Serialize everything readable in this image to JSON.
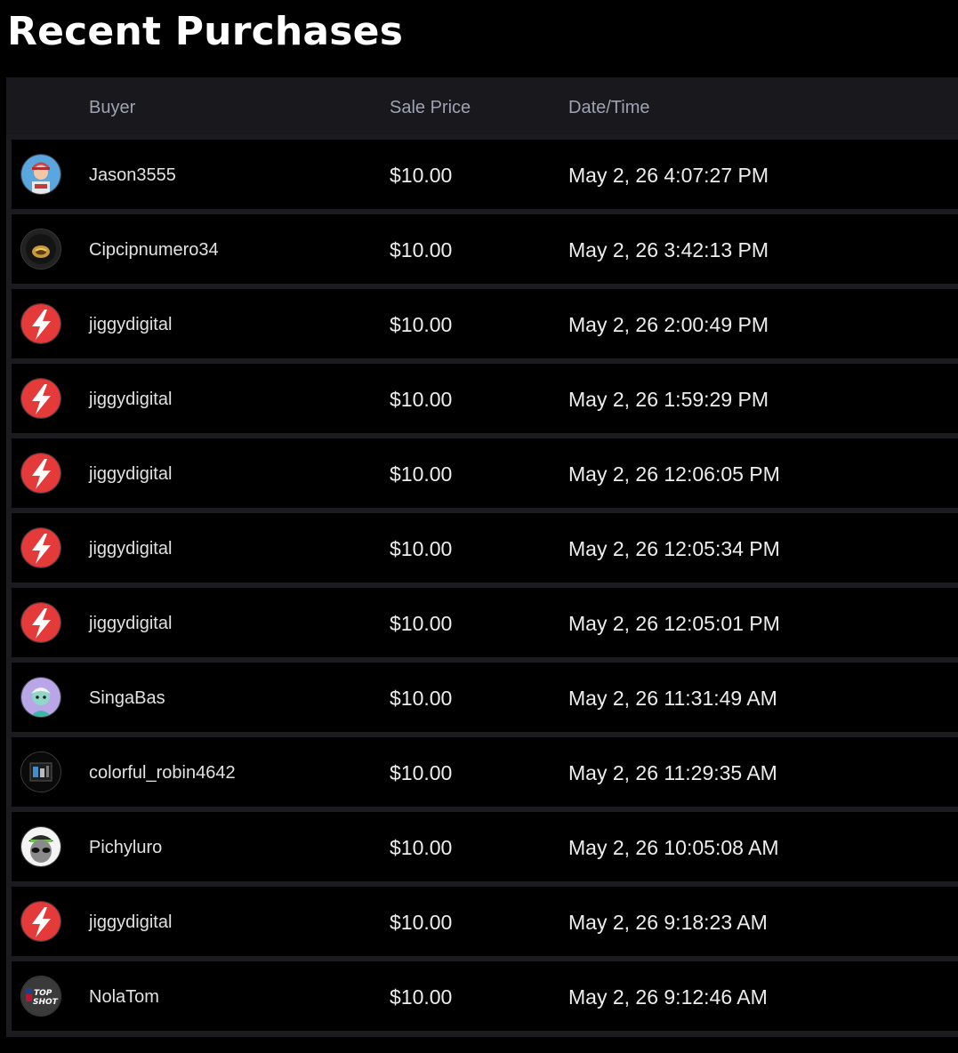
{
  "page": {
    "title": "Recent Purchases"
  },
  "table": {
    "columns": {
      "buyer": "Buyer",
      "sale_price": "Sale Price",
      "date_time": "Date/Time"
    },
    "rows": [
      {
        "buyer": "Jason3555",
        "price": "$10.00",
        "datetime": "May 2, 26 4:07:27 PM",
        "avatar": "jason-avatar-icon"
      },
      {
        "buyer": "Cipcipnumero34",
        "price": "$10.00",
        "datetime": "May 2, 26 3:42:13 PM",
        "avatar": "gold-ring-avatar-icon"
      },
      {
        "buyer": "jiggydigital",
        "price": "$10.00",
        "datetime": "May 2, 26 2:00:49 PM",
        "avatar": "lightning-bolt-avatar-icon"
      },
      {
        "buyer": "jiggydigital",
        "price": "$10.00",
        "datetime": "May 2, 26 1:59:29 PM",
        "avatar": "lightning-bolt-avatar-icon"
      },
      {
        "buyer": "jiggydigital",
        "price": "$10.00",
        "datetime": "May 2, 26 12:06:05 PM",
        "avatar": "lightning-bolt-avatar-icon"
      },
      {
        "buyer": "jiggydigital",
        "price": "$10.00",
        "datetime": "May 2, 26 12:05:34 PM",
        "avatar": "lightning-bolt-avatar-icon"
      },
      {
        "buyer": "jiggydigital",
        "price": "$10.00",
        "datetime": "May 2, 26 12:05:01 PM",
        "avatar": "lightning-bolt-avatar-icon"
      },
      {
        "buyer": "SingaBas",
        "price": "$10.00",
        "datetime": "May 2, 26 11:31:49 AM",
        "avatar": "purple-character-avatar-icon"
      },
      {
        "buyer": "colorful_robin4642",
        "price": "$10.00",
        "datetime": "May 2, 26 11:29:35 AM",
        "avatar": "dark-room-avatar-icon"
      },
      {
        "buyer": "Pichyluro",
        "price": "$10.00",
        "datetime": "May 2, 26 10:05:08 AM",
        "avatar": "alien-avatar-icon"
      },
      {
        "buyer": "jiggydigital",
        "price": "$10.00",
        "datetime": "May 2, 26 9:18:23 AM",
        "avatar": "lightning-bolt-avatar-icon"
      },
      {
        "buyer": "NolaTom",
        "price": "$10.00",
        "datetime": "May 2, 26 9:12:46 AM",
        "avatar": "top-shot-logo-avatar-icon"
      }
    ]
  },
  "colors": {
    "background": "#000000",
    "table_background": "#1c1c20",
    "header_text": "#9ea2b2",
    "row_text": "#ededed",
    "lightning_red": "#e53a3a"
  }
}
